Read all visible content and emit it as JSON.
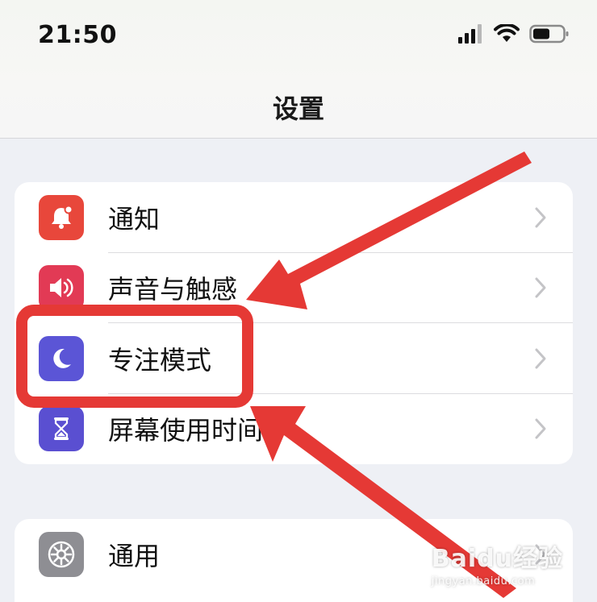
{
  "status_bar": {
    "time": "21:50",
    "icons": [
      "cellular-signal-icon",
      "wifi-icon",
      "battery-icon"
    ]
  },
  "nav": {
    "title": "设置"
  },
  "groups": [
    {
      "rows": [
        {
          "label": "通知",
          "icon": "bell-icon",
          "color": "#e8473b"
        },
        {
          "label": "声音与触感",
          "icon": "speaker-icon",
          "color": "#e23a55"
        },
        {
          "label": "专注模式",
          "icon": "moon-icon",
          "color": "#5b55d6"
        },
        {
          "label": "屏幕使用时间",
          "icon": "hourglass-icon",
          "color": "#5a4fd1"
        }
      ]
    },
    {
      "rows": [
        {
          "label": "通用",
          "icon": "gear-icon",
          "color": "#8e8e93"
        }
      ]
    }
  ],
  "annotations": {
    "highlight_color": "#e53935",
    "highlighted_item": "专注模式"
  },
  "watermark": {
    "main": "Baidu经验",
    "sub": "jingyan.baidu.com"
  }
}
